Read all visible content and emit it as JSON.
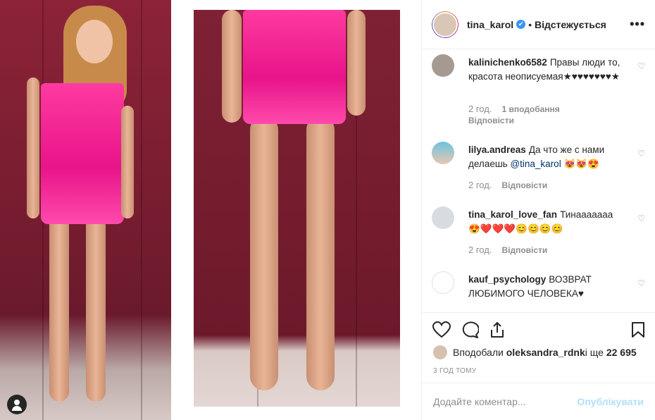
{
  "post": {
    "username": "tina_karol",
    "verified": "✔",
    "follow_label": "Відстежується",
    "more": "•••"
  },
  "comments": [
    {
      "user": "kalinichenko6582",
      "text": "Правы люди то, красота неописуемая★♥♥♥♥♥♥♥★",
      "age": "2 год.",
      "likes": "1 вподобання",
      "reply": "Відповісти"
    },
    {
      "user": "lilya.andreas",
      "text": "Да что же с нами делаешь ",
      "mention": "@tina_karol",
      "emoji": "😻😻😍",
      "age": "2 год.",
      "reply": "Відповісти"
    },
    {
      "user": "tina_karol_love_fan",
      "text": "Тинааааааа",
      "emoji": "😍❤️❤️❤️😊😊😊😊",
      "age": "2 год.",
      "reply": "Відповісти"
    },
    {
      "user": "kauf_psychology",
      "text": "ВОЗВРАТ ЛЮБИМОГО ЧЕЛОВЕКА♥"
    }
  ],
  "likes": {
    "prefix": "Вподобали ",
    "user": "oleksandra_rdnk",
    "and": " і ще ",
    "count": "22 695"
  },
  "time": "3 ГОД ТОМУ",
  "add_comment": {
    "placeholder": "Додайте коментар...",
    "publish": "Опублікувати"
  },
  "colors": {
    "accent": "#3897f0",
    "publish_disabled": "#b2dffc",
    "dress": "#e8148a"
  }
}
